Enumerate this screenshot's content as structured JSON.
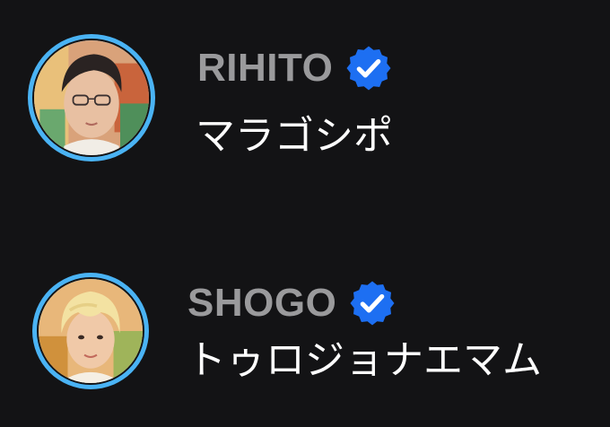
{
  "colors": {
    "background": "#131315",
    "avatar_ring": "#4ab3f4",
    "username": "#9a9a9c",
    "message_text": "#ffffff",
    "verified_badge": "#1d6ff2"
  },
  "entries": [
    {
      "username": "RIHITO",
      "verified_icon": "verified-badge-icon",
      "message": "マラゴシポ",
      "avatar_icon": "profile-photo"
    },
    {
      "username": "SHOGO",
      "verified_icon": "verified-badge-icon",
      "message": "トゥロジョナエマム",
      "avatar_icon": "profile-photo"
    }
  ]
}
